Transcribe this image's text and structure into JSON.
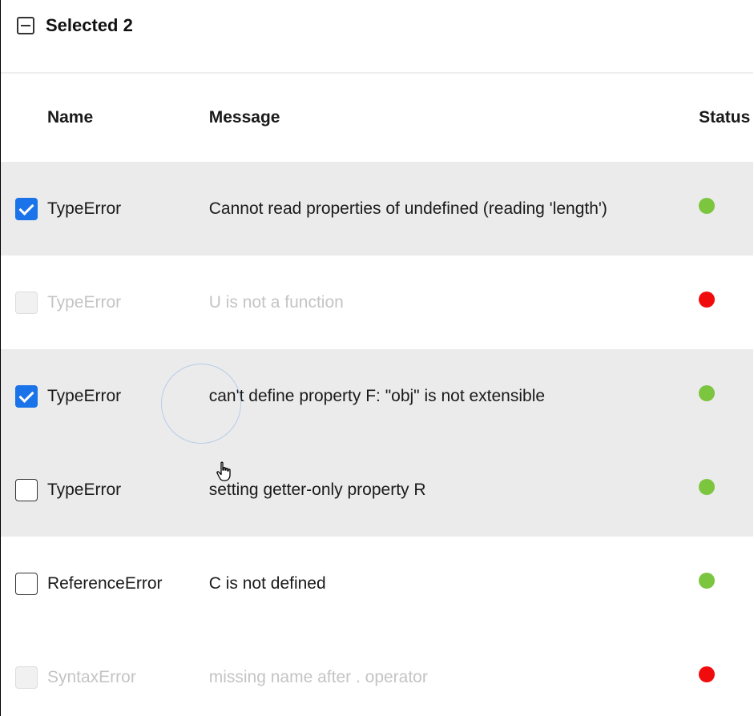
{
  "toolbar": {
    "selected_label": "Selected 2"
  },
  "columns": {
    "name": "Name",
    "message": "Message",
    "status": "Status"
  },
  "rows": [
    {
      "name": "TypeError",
      "message": "Cannot read properties of undefined (reading 'length')",
      "checked": true,
      "disabled": false,
      "status": "green"
    },
    {
      "name": "TypeError",
      "message": "U is not a function",
      "checked": false,
      "disabled": true,
      "status": "red"
    },
    {
      "name": "TypeError",
      "message": "can't define property F: \"obj\" is not extensible",
      "checked": true,
      "disabled": false,
      "status": "green"
    },
    {
      "name": "TypeError",
      "message": "setting getter-only property R",
      "checked": false,
      "disabled": false,
      "status": "green"
    },
    {
      "name": "ReferenceError",
      "message": "C is not defined",
      "checked": false,
      "disabled": false,
      "status": "green"
    },
    {
      "name": "SyntaxError",
      "message": "missing name after . operator",
      "checked": false,
      "disabled": true,
      "status": "red"
    }
  ],
  "colors": {
    "green": "#7cc53f",
    "red": "#f00c0c",
    "checkbox_accent": "#1a73e8",
    "row_highlight": "#ebebeb"
  }
}
